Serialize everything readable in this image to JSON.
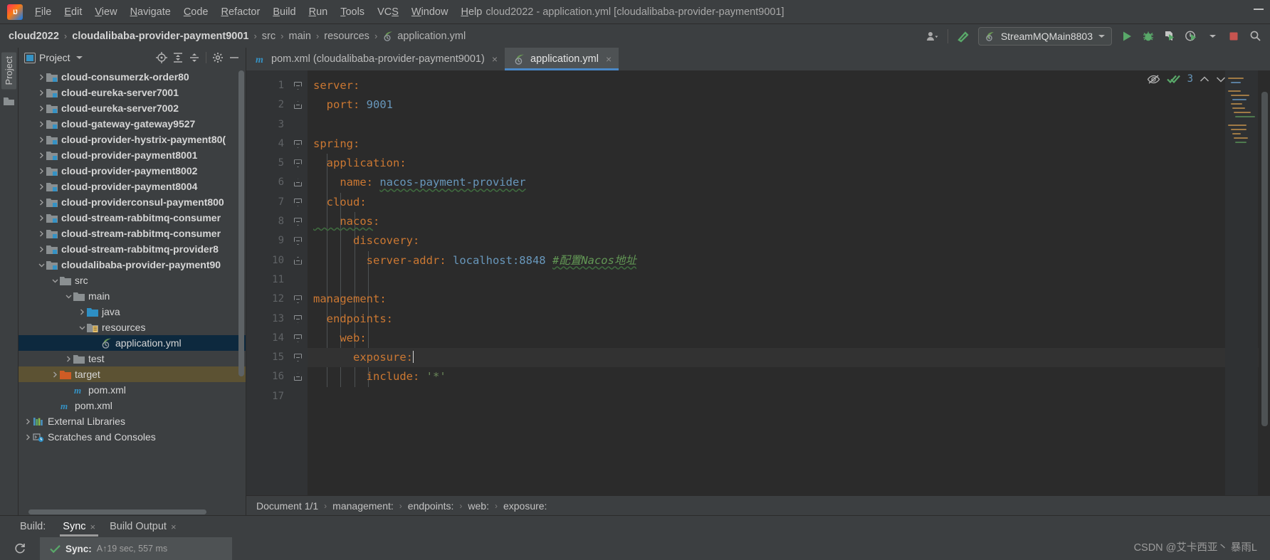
{
  "window": {
    "title": "cloud2022 - application.yml [cloudalibaba-provider-payment9001]",
    "logo_text": "IJ"
  },
  "menu": {
    "items": [
      {
        "label": "File",
        "mnemonic": "F"
      },
      {
        "label": "Edit",
        "mnemonic": "E"
      },
      {
        "label": "View",
        "mnemonic": "V"
      },
      {
        "label": "Navigate",
        "mnemonic": "N"
      },
      {
        "label": "Code",
        "mnemonic": "C"
      },
      {
        "label": "Refactor",
        "mnemonic": "R"
      },
      {
        "label": "Build",
        "mnemonic": "B"
      },
      {
        "label": "Run",
        "mnemonic": "R"
      },
      {
        "label": "Tools",
        "mnemonic": "T"
      },
      {
        "label": "VCS",
        "mnemonic": "S"
      },
      {
        "label": "Window",
        "mnemonic": "W"
      },
      {
        "label": "Help",
        "mnemonic": "H"
      }
    ]
  },
  "navbar": {
    "crumbs": [
      {
        "label": "cloud2022",
        "bold": true
      },
      {
        "label": "cloudalibaba-provider-payment9001",
        "bold": true
      },
      {
        "label": "src",
        "bold": false
      },
      {
        "label": "main",
        "bold": false
      },
      {
        "label": "resources",
        "bold": false
      },
      {
        "label": "application.yml",
        "bold": false,
        "icon": "spring-leaf-icon"
      }
    ],
    "separator": "›",
    "run_config": "StreamMQMain8803",
    "icons": {
      "account": "account-icon",
      "dropdown": "chevron-down-icon",
      "build_hammer": "hammer-icon",
      "run": "run-icon",
      "debug": "debug-icon",
      "run_coverage": "run-with-coverage-icon",
      "profiler": "profiler-icon",
      "stop": "stop-icon",
      "search": "search-icon"
    }
  },
  "left_strip": {
    "tab": "Project",
    "structure_icon": "structure-folder-icon"
  },
  "project_panel": {
    "title": "Project",
    "title_icon": "project-view-icon",
    "dropdown_icon": "chevron-down-icon",
    "toolbar_icons": [
      {
        "name": "locate-icon"
      },
      {
        "name": "expand-all-icon"
      },
      {
        "name": "collapse-all-icon"
      },
      {
        "name": "settings-gear-icon"
      },
      {
        "name": "hide-icon"
      }
    ],
    "tree": [
      {
        "label": "cloud-consumerzk-order80",
        "indent": 1,
        "twist": "collapsed",
        "icon": "module-icon",
        "bold": true,
        "state": ""
      },
      {
        "label": "cloud-eureka-server7001",
        "indent": 1,
        "twist": "collapsed",
        "icon": "module-icon",
        "bold": true,
        "state": ""
      },
      {
        "label": "cloud-eureka-server7002",
        "indent": 1,
        "twist": "collapsed",
        "icon": "module-icon",
        "bold": true,
        "state": ""
      },
      {
        "label": "cloud-gateway-gateway9527",
        "indent": 1,
        "twist": "collapsed",
        "icon": "module-icon",
        "bold": true,
        "state": ""
      },
      {
        "label": "cloud-provider-hystrix-payment80(",
        "indent": 1,
        "twist": "collapsed",
        "icon": "module-icon",
        "bold": true,
        "state": ""
      },
      {
        "label": "cloud-provider-payment8001",
        "indent": 1,
        "twist": "collapsed",
        "icon": "module-icon",
        "bold": true,
        "state": ""
      },
      {
        "label": "cloud-provider-payment8002",
        "indent": 1,
        "twist": "collapsed",
        "icon": "module-icon",
        "bold": true,
        "state": ""
      },
      {
        "label": "cloud-provider-payment8004",
        "indent": 1,
        "twist": "collapsed",
        "icon": "module-icon",
        "bold": true,
        "state": ""
      },
      {
        "label": "cloud-providerconsul-payment800",
        "indent": 1,
        "twist": "collapsed",
        "icon": "module-icon",
        "bold": true,
        "state": ""
      },
      {
        "label": "cloud-stream-rabbitmq-consumer",
        "indent": 1,
        "twist": "collapsed",
        "icon": "module-icon",
        "bold": true,
        "state": ""
      },
      {
        "label": "cloud-stream-rabbitmq-consumer",
        "indent": 1,
        "twist": "collapsed",
        "icon": "module-icon",
        "bold": true,
        "state": ""
      },
      {
        "label": "cloud-stream-rabbitmq-provider8",
        "indent": 1,
        "twist": "collapsed",
        "icon": "module-icon",
        "bold": true,
        "state": ""
      },
      {
        "label": "cloudalibaba-provider-payment90",
        "indent": 1,
        "twist": "expanded",
        "icon": "module-icon",
        "bold": true,
        "state": ""
      },
      {
        "label": "src",
        "indent": 2,
        "twist": "expanded",
        "icon": "folder-icon",
        "bold": false,
        "state": ""
      },
      {
        "label": "main",
        "indent": 3,
        "twist": "expanded",
        "icon": "folder-icon",
        "bold": false,
        "state": ""
      },
      {
        "label": "java",
        "indent": 4,
        "twist": "collapsed",
        "icon": "source-root-icon",
        "bold": false,
        "state": ""
      },
      {
        "label": "resources",
        "indent": 4,
        "twist": "expanded",
        "icon": "resources-root-icon",
        "bold": false,
        "state": ""
      },
      {
        "label": "application.yml",
        "indent": 5,
        "twist": "none",
        "icon": "spring-leaf-icon",
        "bold": false,
        "state": "selected"
      },
      {
        "label": "test",
        "indent": 3,
        "twist": "collapsed",
        "icon": "folder-icon",
        "bold": false,
        "state": ""
      },
      {
        "label": "target",
        "indent": 2,
        "twist": "collapsed",
        "icon": "target-folder-icon",
        "bold": false,
        "state": "highlighted"
      },
      {
        "label": "pom.xml",
        "indent": 3,
        "twist": "none",
        "icon": "maven-icon",
        "bold": false,
        "state": ""
      },
      {
        "label": "pom.xml",
        "indent": 2,
        "twist": "none",
        "icon": "maven-icon",
        "bold": false,
        "state": ""
      },
      {
        "label": "External Libraries",
        "indent": 0,
        "twist": "collapsed",
        "icon": "library-icon",
        "bold": false,
        "state": ""
      },
      {
        "label": "Scratches and Consoles",
        "indent": 0,
        "twist": "collapsed",
        "icon": "scratches-icon",
        "bold": false,
        "state": ""
      }
    ]
  },
  "editor": {
    "tabs": [
      {
        "label": "pom.xml (cloudalibaba-provider-payment9001)",
        "icon": "maven-icon",
        "active": false,
        "close": "×"
      },
      {
        "label": "application.yml",
        "icon": "spring-leaf-icon",
        "active": true,
        "close": "×"
      }
    ],
    "inspection": {
      "eye_icon": "eye-off-icon",
      "check_icon": "inspection-ok-icon",
      "count": "3",
      "prev_icon": "chevron-up-icon",
      "next_icon": "chevron-down-icon"
    },
    "line_numbers": [
      "1",
      "2",
      "3",
      "4",
      "5",
      "6",
      "7",
      "8",
      "9",
      "10",
      "11",
      "12",
      "13",
      "14",
      "15",
      "16",
      "17"
    ],
    "lines": [
      {
        "n": 1,
        "fold": "top",
        "indent": 0,
        "tokens": [
          {
            "t": "server",
            "c": "k"
          },
          {
            "t": ":",
            "c": "k"
          }
        ]
      },
      {
        "n": 2,
        "fold": "bot",
        "indent": 1,
        "tokens": [
          {
            "t": "  port",
            "c": "k"
          },
          {
            "t": ": ",
            "c": "k"
          },
          {
            "t": "9001",
            "c": "v"
          }
        ]
      },
      {
        "n": 3,
        "fold": "",
        "indent": 0,
        "tokens": []
      },
      {
        "n": 4,
        "fold": "top",
        "indent": 0,
        "tokens": [
          {
            "t": "spring",
            "c": "k"
          },
          {
            "t": ":",
            "c": "k"
          }
        ]
      },
      {
        "n": 5,
        "fold": "top",
        "indent": 1,
        "tokens": [
          {
            "t": "  application",
            "c": "k"
          },
          {
            "t": ":",
            "c": "k"
          }
        ]
      },
      {
        "n": 6,
        "fold": "bot",
        "indent": 2,
        "tokens": [
          {
            "t": "    name",
            "c": "k"
          },
          {
            "t": ": ",
            "c": "k"
          },
          {
            "t": "nacos-payment-provider",
            "c": "v wavy"
          }
        ]
      },
      {
        "n": 7,
        "fold": "top",
        "indent": 1,
        "tokens": [
          {
            "t": "  cloud",
            "c": "k"
          },
          {
            "t": ":",
            "c": "k"
          }
        ]
      },
      {
        "n": 8,
        "fold": "top",
        "indent": 2,
        "tokens": [
          {
            "t": "    nacos",
            "c": "k wavy"
          },
          {
            "t": ":",
            "c": "k"
          }
        ]
      },
      {
        "n": 9,
        "fold": "top",
        "indent": 3,
        "tokens": [
          {
            "t": "      discovery",
            "c": "k"
          },
          {
            "t": ":",
            "c": "k"
          }
        ]
      },
      {
        "n": 10,
        "fold": "bot",
        "indent": 4,
        "tokens": [
          {
            "t": "        server-addr",
            "c": "k"
          },
          {
            "t": ": ",
            "c": "k"
          },
          {
            "t": "localhost:8848",
            "c": "v"
          },
          {
            "t": " ",
            "c": ""
          },
          {
            "t": "#配置Nacos地址",
            "c": "cmt wavy"
          }
        ]
      },
      {
        "n": 11,
        "fold": "",
        "indent": 0,
        "tokens": []
      },
      {
        "n": 12,
        "fold": "top",
        "indent": 0,
        "tokens": [
          {
            "t": "management",
            "c": "k"
          },
          {
            "t": ":",
            "c": "k"
          }
        ]
      },
      {
        "n": 13,
        "fold": "top",
        "indent": 1,
        "tokens": [
          {
            "t": "  endpoints",
            "c": "k"
          },
          {
            "t": ":",
            "c": "k"
          }
        ]
      },
      {
        "n": 14,
        "fold": "top",
        "indent": 2,
        "tokens": [
          {
            "t": "    web",
            "c": "k"
          },
          {
            "t": ":",
            "c": "k"
          }
        ]
      },
      {
        "n": 15,
        "fold": "top",
        "indent": 3,
        "tokens": [
          {
            "t": "      exposure",
            "c": "k"
          },
          {
            "t": ":",
            "c": "k"
          }
        ],
        "caret": true,
        "current": true
      },
      {
        "n": 16,
        "fold": "bot",
        "indent": 4,
        "tokens": [
          {
            "t": "        include",
            "c": "k"
          },
          {
            "t": ": ",
            "c": "k"
          },
          {
            "t": "'*'",
            "c": "str"
          }
        ]
      },
      {
        "n": 17,
        "fold": "",
        "indent": 0,
        "tokens": []
      }
    ],
    "breadcrumbs": {
      "items": [
        "Document 1/1",
        "management:",
        "endpoints:",
        "web:",
        "exposure:"
      ],
      "separator": "›"
    }
  },
  "bottom_panel": {
    "label": "Build:",
    "tabs": [
      {
        "label": "Sync",
        "active": true,
        "close": "×"
      },
      {
        "label": "Build Output",
        "active": false,
        "close": "×"
      }
    ],
    "refresh_icon": "refresh-icon",
    "status": {
      "check_icon": "success-check-icon",
      "title": "Sync:",
      "detail": "A↑19 sec, 557 ms"
    }
  },
  "watermark": "CSDN @艾卡西亚丶 暴雨L",
  "colors": {
    "background": "#3c3f41",
    "editor_background": "#2b2b2b",
    "gutter": "#313335",
    "accent_blue": "#4a88c7",
    "selection": "#0d293e",
    "key_orange": "#cc7832",
    "value_blue": "#6897bb",
    "string_green": "#6a8759",
    "comment_green": "#629755",
    "target_highlight": "#5c5233",
    "run_green": "#59a869",
    "stop_red": "#c75450"
  }
}
